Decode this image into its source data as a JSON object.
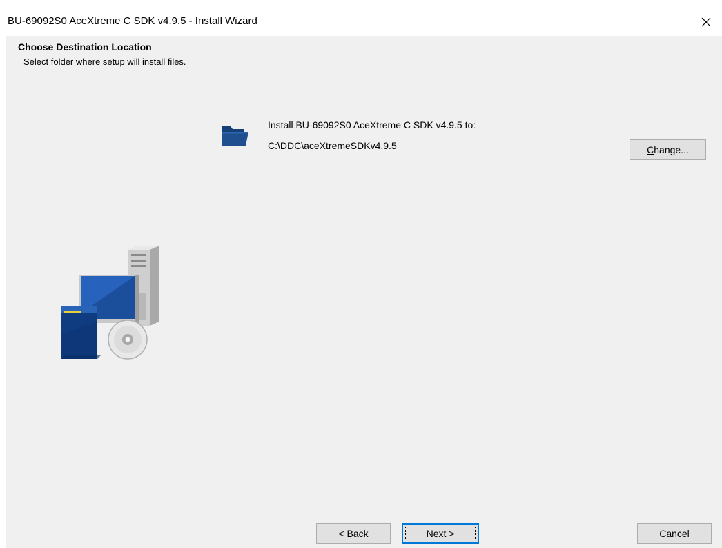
{
  "window": {
    "title": "BU-69092S0 AceXtreme C SDK v4.9.5 - Install Wizard"
  },
  "header": {
    "title": "Choose Destination Location",
    "subtitle": "Select folder where setup will install files."
  },
  "destination": {
    "label": "Install BU-69092S0 AceXtreme C SDK v4.9.5 to:",
    "path": "C:\\DDC\\aceXtremeSDKv4.9.5",
    "change_prefix": "",
    "change_mnemonic": "C",
    "change_rest": "hange..."
  },
  "buttons": {
    "back_prefix": "< ",
    "back_mnemonic": "B",
    "back_rest": "ack",
    "next_mnemonic": "N",
    "next_rest": "ext >",
    "cancel": "Cancel"
  },
  "icons": {
    "close": "close-icon",
    "folder": "folder-icon",
    "setup": "setup-computer-illustration"
  },
  "colors": {
    "accent": "#0078d7",
    "folder": "#1f4f8f",
    "window_bg": "#f0f0f0"
  }
}
